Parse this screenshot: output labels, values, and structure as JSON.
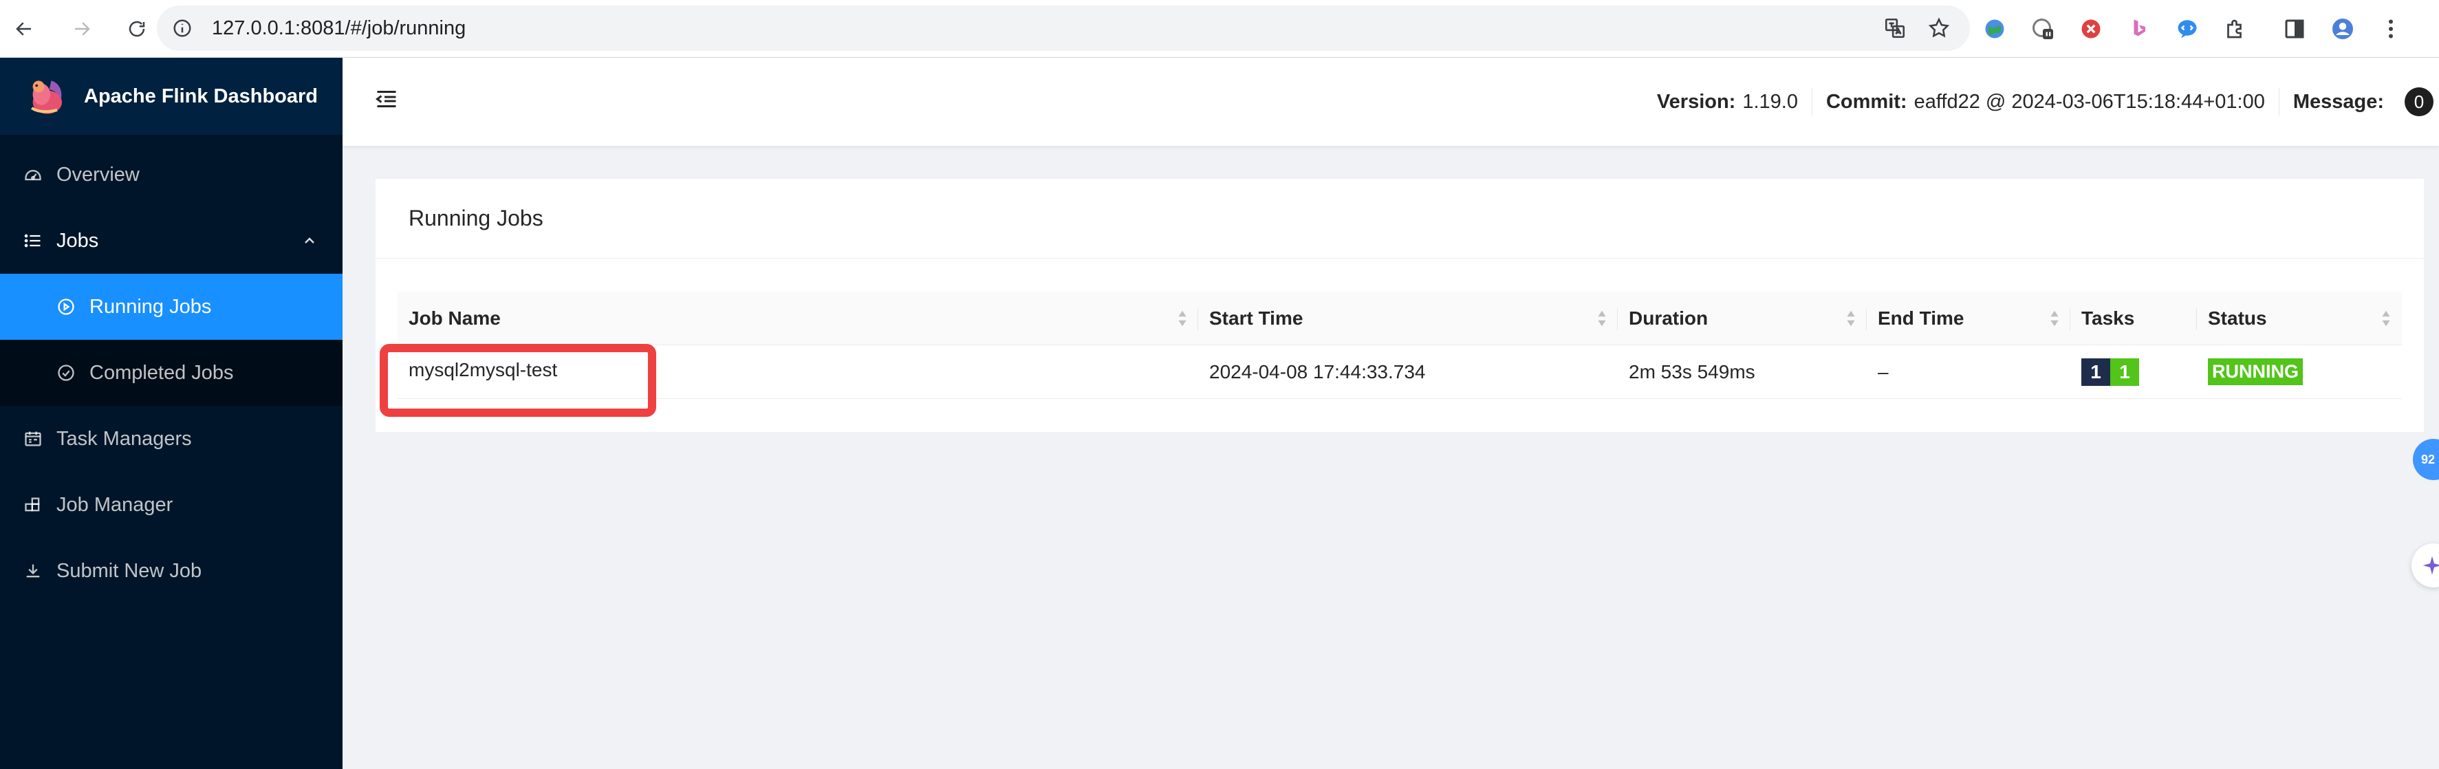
{
  "browser": {
    "url": "127.0.0.1:8081/#/job/running"
  },
  "sidebar": {
    "app_title": "Apache Flink Dashboard",
    "items": [
      {
        "label": "Overview",
        "icon": "dashboard-icon"
      },
      {
        "label": "Jobs",
        "icon": "list-icon"
      },
      {
        "label": "Running Jobs",
        "icon": "play-circle-icon"
      },
      {
        "label": "Completed Jobs",
        "icon": "check-circle-icon"
      },
      {
        "label": "Task Managers",
        "icon": "schedule-icon"
      },
      {
        "label": "Job Manager",
        "icon": "build-icon"
      },
      {
        "label": "Submit New Job",
        "icon": "upload-icon"
      }
    ]
  },
  "header": {
    "version_label": "Version:",
    "version_value": "1.19.0",
    "commit_label": "Commit:",
    "commit_value": "eaffd22 @ 2024-03-06T15:18:44+01:00",
    "message_label": "Message:",
    "message_count": "0"
  },
  "card": {
    "title": "Running Jobs"
  },
  "table": {
    "columns": [
      "Job Name",
      "Start Time",
      "Duration",
      "End Time",
      "Tasks",
      "Status"
    ],
    "rows": [
      {
        "job_name": "mysql2mysql-test",
        "start_time": "2024-04-08 17:44:33.734",
        "duration": "2m 53s 549ms",
        "end_time": "–",
        "tasks_total": "1",
        "tasks_running": "1",
        "status": "RUNNING"
      }
    ]
  },
  "floating": {
    "badge_text": "92"
  },
  "colors": {
    "sidebar_bg": "#001529",
    "active_item": "#1890ff",
    "running_green": "#52c41a",
    "highlight_red": "#ef4040"
  }
}
